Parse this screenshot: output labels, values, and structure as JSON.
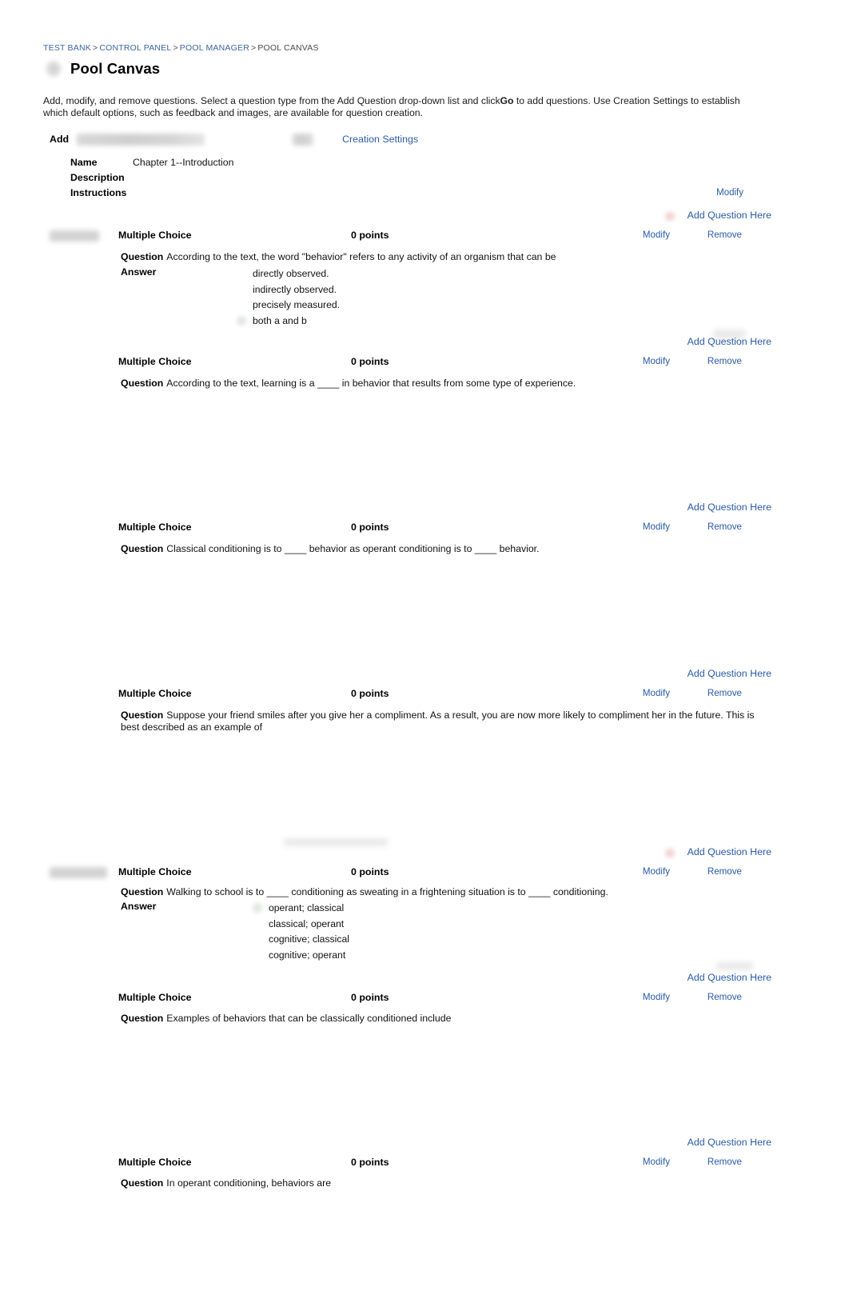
{
  "breadcrumb": {
    "items": [
      {
        "label": "TEST BANK",
        "link": true
      },
      {
        "label": "CONTROL PANEL",
        "link": true
      },
      {
        "label": "POOL MANAGER",
        "link": true
      },
      {
        "label": "POOL CANVAS",
        "link": false
      }
    ],
    "separator": ">"
  },
  "header": {
    "title": "Pool Canvas",
    "icon": "pool-canvas-icon"
  },
  "intro": {
    "part1": "Add, modify, and remove questions. Select a question type from the Add Question drop-down list and click",
    "bold": "Go",
    "part2": "to add questions. Use Creation Settings to establish which default options, such as feedback and images, are available for question creation."
  },
  "toolbar": {
    "add_label": "Add",
    "creation_settings_label": "Creation Settings"
  },
  "meta": {
    "name_label": "Name",
    "name_value": "Chapter 1--Introduction",
    "description_label": "Description",
    "description_value": "",
    "instructions_label": "Instructions",
    "instructions_value": "",
    "modify_label": "Modify"
  },
  "labels": {
    "add_question_here": "Add Question Here",
    "modify": "Modify",
    "remove": "Remove",
    "question": "Question",
    "answer": "Answer"
  },
  "colors": {
    "link": "#2a5ba7",
    "breadcrumb_link": "#3a66a0",
    "text": "#111111",
    "background": "#ffffff"
  },
  "questions": [
    {
      "type": "Multiple Choice",
      "points": "0 points",
      "question": "According to the text, the word \"behavior\" refers to any activity of an organism that can be",
      "answers": [
        "directly observed.",
        "indirectly observed.",
        "precisely measured.",
        "both a and b"
      ]
    },
    {
      "type": "Multiple Choice",
      "points": "0 points",
      "question": "According to the text, learning is a ____ in behavior that results from some type of experience.",
      "answers": []
    },
    {
      "type": "Multiple Choice",
      "points": "0 points",
      "question": "Classical conditioning is to ____ behavior as operant conditioning is to ____ behavior.",
      "answers": []
    },
    {
      "type": "Multiple Choice",
      "points": "0 points",
      "question": "Suppose your friend smiles after you give her a compliment. As a result, you are now more likely to compliment her in the future. This is best described as an example of",
      "answers": []
    },
    {
      "type": "Multiple Choice",
      "points": "0 points",
      "question": "Walking to school is to ____ conditioning as sweating in a frightening situation is to ____ conditioning.",
      "answers": [
        "operant; classical",
        "classical; operant",
        "cognitive; classical",
        "cognitive; operant"
      ]
    },
    {
      "type": "Multiple Choice",
      "points": "0 points",
      "question": "Examples of behaviors that can be classically conditioned include",
      "answers": []
    },
    {
      "type": "Multiple Choice",
      "points": "0 points",
      "question": "In operant conditioning, behaviors are",
      "answers": []
    }
  ]
}
